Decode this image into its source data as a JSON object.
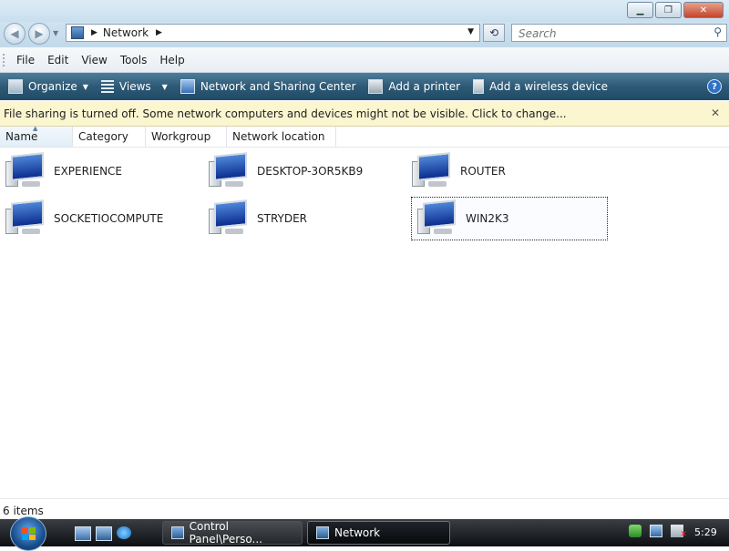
{
  "window": {
    "buttons": {
      "minimize": "▁",
      "maximize": "❐",
      "close": "✕"
    }
  },
  "address": {
    "crumb": "Network",
    "search_placeholder": "Search"
  },
  "menubar": {
    "items": [
      "File",
      "Edit",
      "View",
      "Tools",
      "Help"
    ]
  },
  "commandbar": {
    "organize": "Organize",
    "views": "Views",
    "network_sharing": "Network and Sharing Center",
    "add_printer": "Add a printer",
    "add_wireless": "Add a wireless device",
    "help": "?"
  },
  "infobar": {
    "message": "File sharing is turned off. Some network computers and devices might not be visible. Click to change...",
    "close": "✕"
  },
  "columns": [
    "Name",
    "Category",
    "Workgroup",
    "Network location"
  ],
  "items": [
    {
      "name": "EXPERIENCE",
      "icon": "computer-icon"
    },
    {
      "name": "DESKTOP-3OR5KB9",
      "icon": "computer-icon"
    },
    {
      "name": "ROUTER",
      "icon": "computer-icon"
    },
    {
      "name": "SOCKETIOCOMPUTE",
      "icon": "computer-icon"
    },
    {
      "name": "STRYDER",
      "icon": "computer-icon"
    },
    {
      "name": "WIN2K3",
      "icon": "computer-icon",
      "selected": true
    }
  ],
  "status": {
    "count": "6 items"
  },
  "taskbar": {
    "tasks": [
      "Control Panel\\Perso...",
      "Network"
    ],
    "clock": "5:29"
  },
  "colors": {
    "commandbar": "#2d5a76",
    "infobar": "#fbf6d0",
    "taskbar": "#0d0f12"
  }
}
